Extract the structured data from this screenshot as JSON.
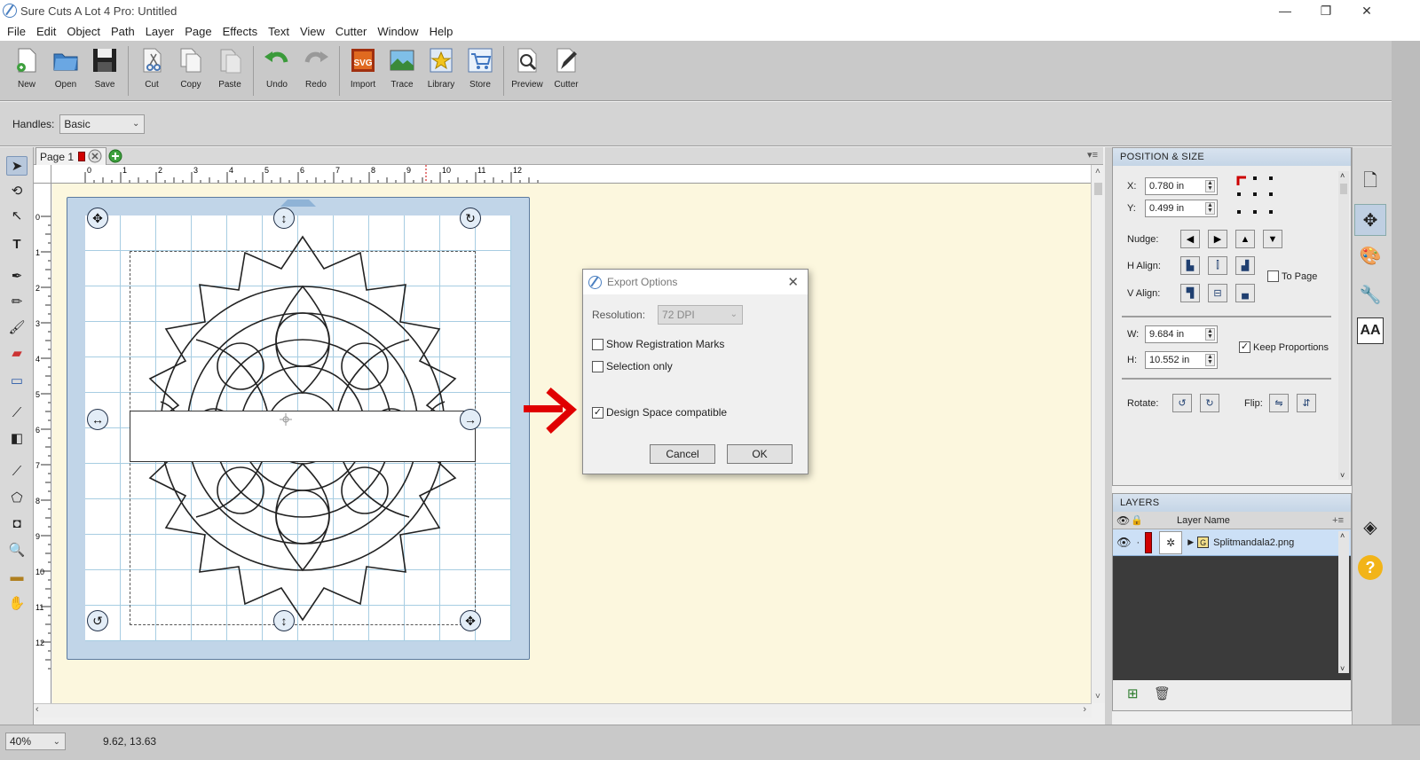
{
  "window": {
    "title": "Sure Cuts A Lot 4 Pro: Untitled",
    "minimize": "—",
    "maximize": "❐",
    "close": "✕"
  },
  "menu": [
    "File",
    "Edit",
    "Object",
    "Path",
    "Layer",
    "Page",
    "Effects",
    "Text",
    "View",
    "Cutter",
    "Window",
    "Help"
  ],
  "toolbar": {
    "new": "New",
    "open": "Open",
    "save": "Save",
    "cut": "Cut",
    "copy": "Copy",
    "paste": "Paste",
    "undo": "Undo",
    "redo": "Redo",
    "import": "Import",
    "trace": "Trace",
    "library": "Library",
    "store": "Store",
    "preview": "Preview",
    "cutter": "Cutter",
    "svg_badge": "SVG"
  },
  "handles": {
    "label": "Handles:",
    "value": "Basic"
  },
  "pages": {
    "tab_label": "Page 1"
  },
  "ruler": {
    "top": [
      "0",
      "1",
      "2",
      "3",
      "4",
      "5",
      "6",
      "7",
      "8",
      "9",
      "10",
      "11",
      "12"
    ],
    "left": [
      "0",
      "1",
      "2",
      "3",
      "4",
      "5",
      "6",
      "7",
      "8",
      "9",
      "10",
      "11",
      "12"
    ]
  },
  "export_dialog": {
    "title": "Export Options",
    "resolution_label": "Resolution:",
    "resolution_value": "72 DPI",
    "show_registration": "Show Registration Marks",
    "selection_only": "Selection only",
    "design_space": "Design Space compatible",
    "design_space_checked": true,
    "cancel": "Cancel",
    "ok": "OK"
  },
  "position_size": {
    "header": "POSITION & SIZE",
    "x_label": "X:",
    "x_value": "0.780 in",
    "y_label": "Y:",
    "y_value": "0.499 in",
    "nudge_label": "Nudge:",
    "halign_label": "H Align:",
    "valign_label": "V Align:",
    "to_page": "To Page",
    "w_label": "W:",
    "w_value": "9.684 in",
    "h_label": "H:",
    "h_value": "10.552 in",
    "keep_proportions": "Keep Proportions",
    "rotate_label": "Rotate:",
    "flip_label": "Flip:"
  },
  "layers": {
    "header": "LAYERS",
    "column_name": "Layer Name",
    "items": [
      {
        "name": "Splitmandala2.png",
        "group_badge": "G",
        "color": "#d10000"
      }
    ]
  },
  "status": {
    "zoom": "40%",
    "coords": "9.62, 13.63"
  },
  "colors": {
    "accent_red": "#e00000",
    "mat_blue": "#c1d5e8",
    "canvas_bg": "#fcf7de",
    "selection_blue": "#cce0f6"
  }
}
